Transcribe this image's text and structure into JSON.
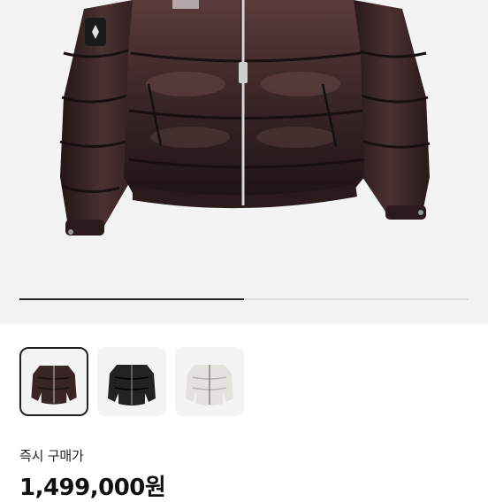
{
  "gallery": {
    "progress_fraction": 0.5,
    "thumbnails": [
      {
        "name": "thumb-jacket-brown",
        "selected": true,
        "jacket_color": "#3a2526"
      },
      {
        "name": "thumb-jacket-black",
        "selected": false,
        "jacket_color": "#222222"
      },
      {
        "name": "thumb-jacket-white",
        "selected": false,
        "jacket_color": "#e4e2de"
      }
    ]
  },
  "purchase": {
    "label": "즉시 구매가",
    "price": "1,499,000원"
  },
  "colors": {
    "hero_bg": "#f3f3f3",
    "jacket_main": "#3a2526",
    "jacket_shadow": "#241617",
    "jacket_highlight": "#6b4d4c"
  }
}
